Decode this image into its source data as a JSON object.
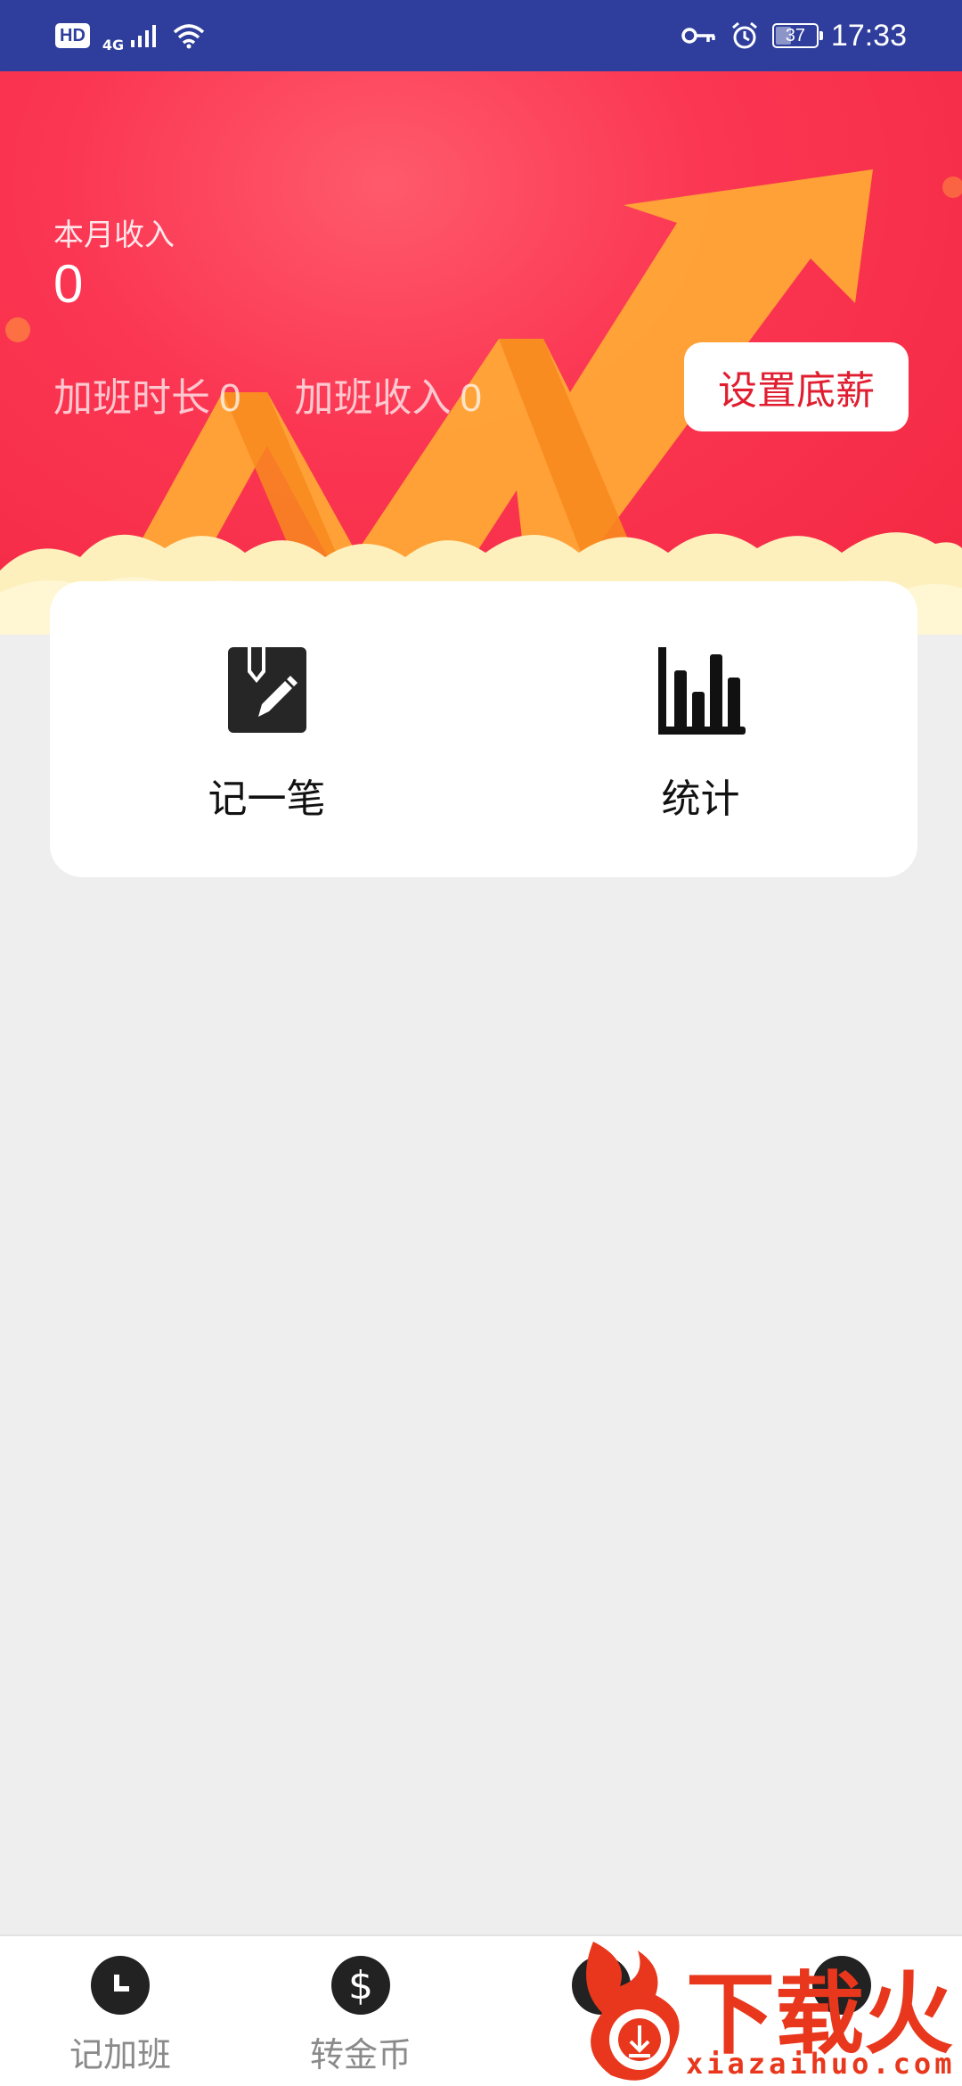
{
  "status_bar": {
    "hd": "HD",
    "network": "4G",
    "battery": "37",
    "time": "17:33"
  },
  "header": {
    "income_label": "本月收入",
    "income_value": "0",
    "overtime_hours_label": "加班时长",
    "overtime_hours_value": "0",
    "overtime_income_label": "加班收入",
    "overtime_income_value": "0",
    "set_salary_button": "设置底薪"
  },
  "actions": [
    {
      "label": "记一笔",
      "icon": "edit-note-icon"
    },
    {
      "label": "统计",
      "icon": "bar-chart-icon"
    }
  ],
  "bottom_nav": [
    {
      "label": "记加班",
      "icon": "clock-icon"
    },
    {
      "label": "转金币",
      "icon": "dollar-icon"
    },
    {
      "label": "",
      "icon": "hidden-nav-icon"
    },
    {
      "label": "",
      "icon": "hidden-nav-icon"
    }
  ],
  "watermark": {
    "cn": "下载火",
    "en": "xiazaihuo.com"
  },
  "colors": {
    "status_bar": "#2f3e9c",
    "banner_red": "#f32742",
    "button_text": "#e01e30",
    "background": "#eeeeee"
  }
}
